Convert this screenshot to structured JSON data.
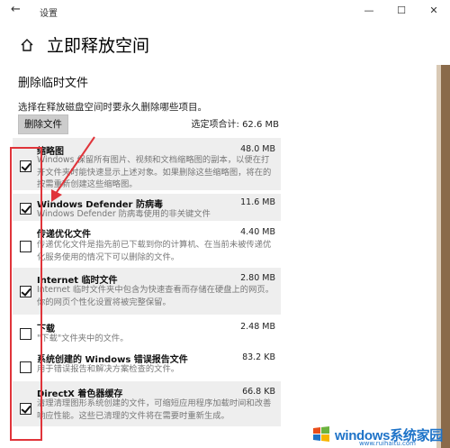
{
  "window": {
    "title": "设置",
    "back": "←",
    "min": "—",
    "max": "☐",
    "close": "✕"
  },
  "header": {
    "title": "立即释放空间"
  },
  "section": {
    "title": "删除临时文件",
    "description": "选择在释放磁盘空间时要永久删除哪些项目。",
    "delete_button": "删除文件",
    "total_label": "选定项合计: 62.6 MB"
  },
  "items": [
    {
      "name": "缩略图",
      "size": "48.0 MB",
      "checked": true,
      "desc": "Windows 保留所有图片、视频和文档缩略图的副本，以便在打开文件夹时能快速显示上述对象。如果删除这些缩略图，将在的按需重新创建这些缩略图。"
    },
    {
      "name": "Windows Defender 防病毒",
      "size": "11.6 MB",
      "checked": true,
      "desc": "Windows Defender 防病毒使用的非关键文件"
    },
    {
      "name": "传递优化文件",
      "size": "4.40 MB",
      "checked": false,
      "desc": "传递优化文件是指先前已下载到你的计算机、在当前未被传递优化服务使用的情况下可以删除的文件。"
    },
    {
      "name": "Internet 临时文件",
      "size": "2.80 MB",
      "checked": true,
      "desc": "Internet 临时文件夹中包含为快速查看而存储在硬盘上的网页。你的网页个性化设置将被完整保留。"
    },
    {
      "name": "下载",
      "size": "2.48 MB",
      "checked": false,
      "desc": "\"下载\"文件夹中的文件。"
    },
    {
      "name": "系统创建的 Windows 错误报告文件",
      "size": "83.2 KB",
      "checked": false,
      "desc": "用于错误报告和解决方案检查的文件。"
    },
    {
      "name": "DirectX 着色器缓存",
      "size": "66.8 KB",
      "checked": true,
      "desc": "清理清理图形系统创建的文件，可缩短应用程序加载时间和改善响应性能。这些已清理的文件将在需要时重新生成。"
    }
  ],
  "watermark": {
    "text": "windows系统家园",
    "sub": "www.ruihaitu.com"
  },
  "colors": {
    "annotation": "#e0343a",
    "brand": "#1e73c8"
  }
}
